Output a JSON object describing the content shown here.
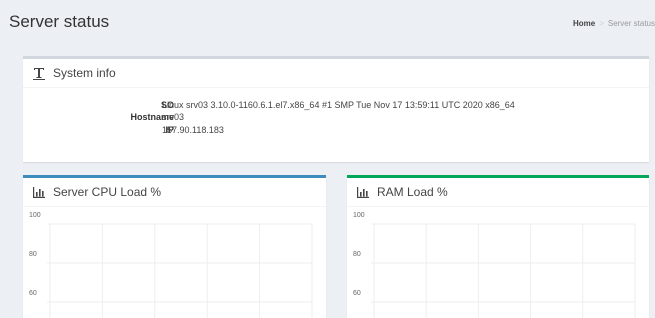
{
  "header": {
    "title": "Server status",
    "breadcrumb_home": "Home",
    "breadcrumb_current": "Server status"
  },
  "system_info": {
    "title": "System info",
    "icon": "text-icon",
    "rows": [
      {
        "label": "SO",
        "value": "Linux srv03 3.10.0-1160.6.1.el7.x86_64 #1 SMP Tue Nov 17 13:59:11 UTC 2020 x86_64"
      },
      {
        "label": "Hostname",
        "value": "srv03"
      },
      {
        "label": "IP",
        "value": "157.90.118.183"
      }
    ]
  },
  "cpu_panel": {
    "title": "Server CPU Load %",
    "icon": "bar-chart-icon",
    "accent": "#3c8dbc"
  },
  "ram_panel": {
    "title": "RAM Load %",
    "icon": "bar-chart-icon",
    "accent": "#00a65a"
  },
  "chart_data": [
    {
      "type": "line",
      "title": "Server CPU Load %",
      "yticks": [
        100,
        80,
        60
      ],
      "series": []
    },
    {
      "type": "line",
      "title": "RAM Load %",
      "yticks": [
        100,
        80,
        60
      ],
      "series": []
    }
  ]
}
